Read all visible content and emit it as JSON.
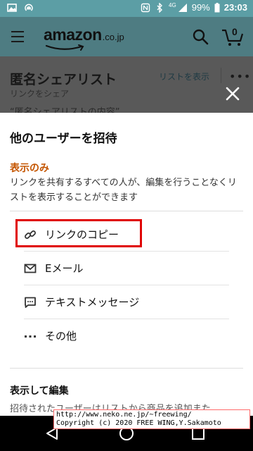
{
  "status_bar": {
    "battery_percent": "99%",
    "time": "23:03",
    "network_badge": "4G",
    "icons": [
      "image-icon",
      "wifi-hotspot-icon",
      "nfc-icon",
      "bluetooth-icon",
      "cellular-signal-icon",
      "battery-icon"
    ]
  },
  "header": {
    "logo_text": "amazon",
    "logo_suffix": ".co.jp",
    "icons": [
      "menu-icon",
      "search-icon",
      "cart-icon"
    ],
    "cart_count": "0"
  },
  "background_page": {
    "title": "匿名シェアリスト",
    "subtitle": "リンクをシェア",
    "description": "“匿名シェアリストの内容”",
    "view_list_link": "リストを表示",
    "more_label": "•••"
  },
  "sheet": {
    "title": "他のユーザーを招待",
    "view_only": {
      "label": "表示のみ",
      "description": "リンクを共有するすべての人が、編集を行うことなくリストを表示することができます"
    },
    "options": [
      {
        "label": "リンクのコピー",
        "icon": "link-icon"
      },
      {
        "label": "Eメール",
        "icon": "email-icon"
      },
      {
        "label": "テキストメッセージ",
        "icon": "text-message-icon"
      },
      {
        "label": "その他",
        "icon": "more-dots-icon"
      }
    ],
    "view_edit": {
      "label": "表示して編集",
      "description": "招待されたユーザーはリストから商品を追加また"
    }
  },
  "watermark": {
    "line1": "http://www.neko.ne.jp/~freewing/",
    "line2": "Copyright (c) 2020 FREE WING,Y.Sakamoto"
  },
  "colors": {
    "status_bar": "#5c9ea5",
    "header": "#4e7c82",
    "accent_orange": "#c45500",
    "highlight_red": "#e00000"
  }
}
